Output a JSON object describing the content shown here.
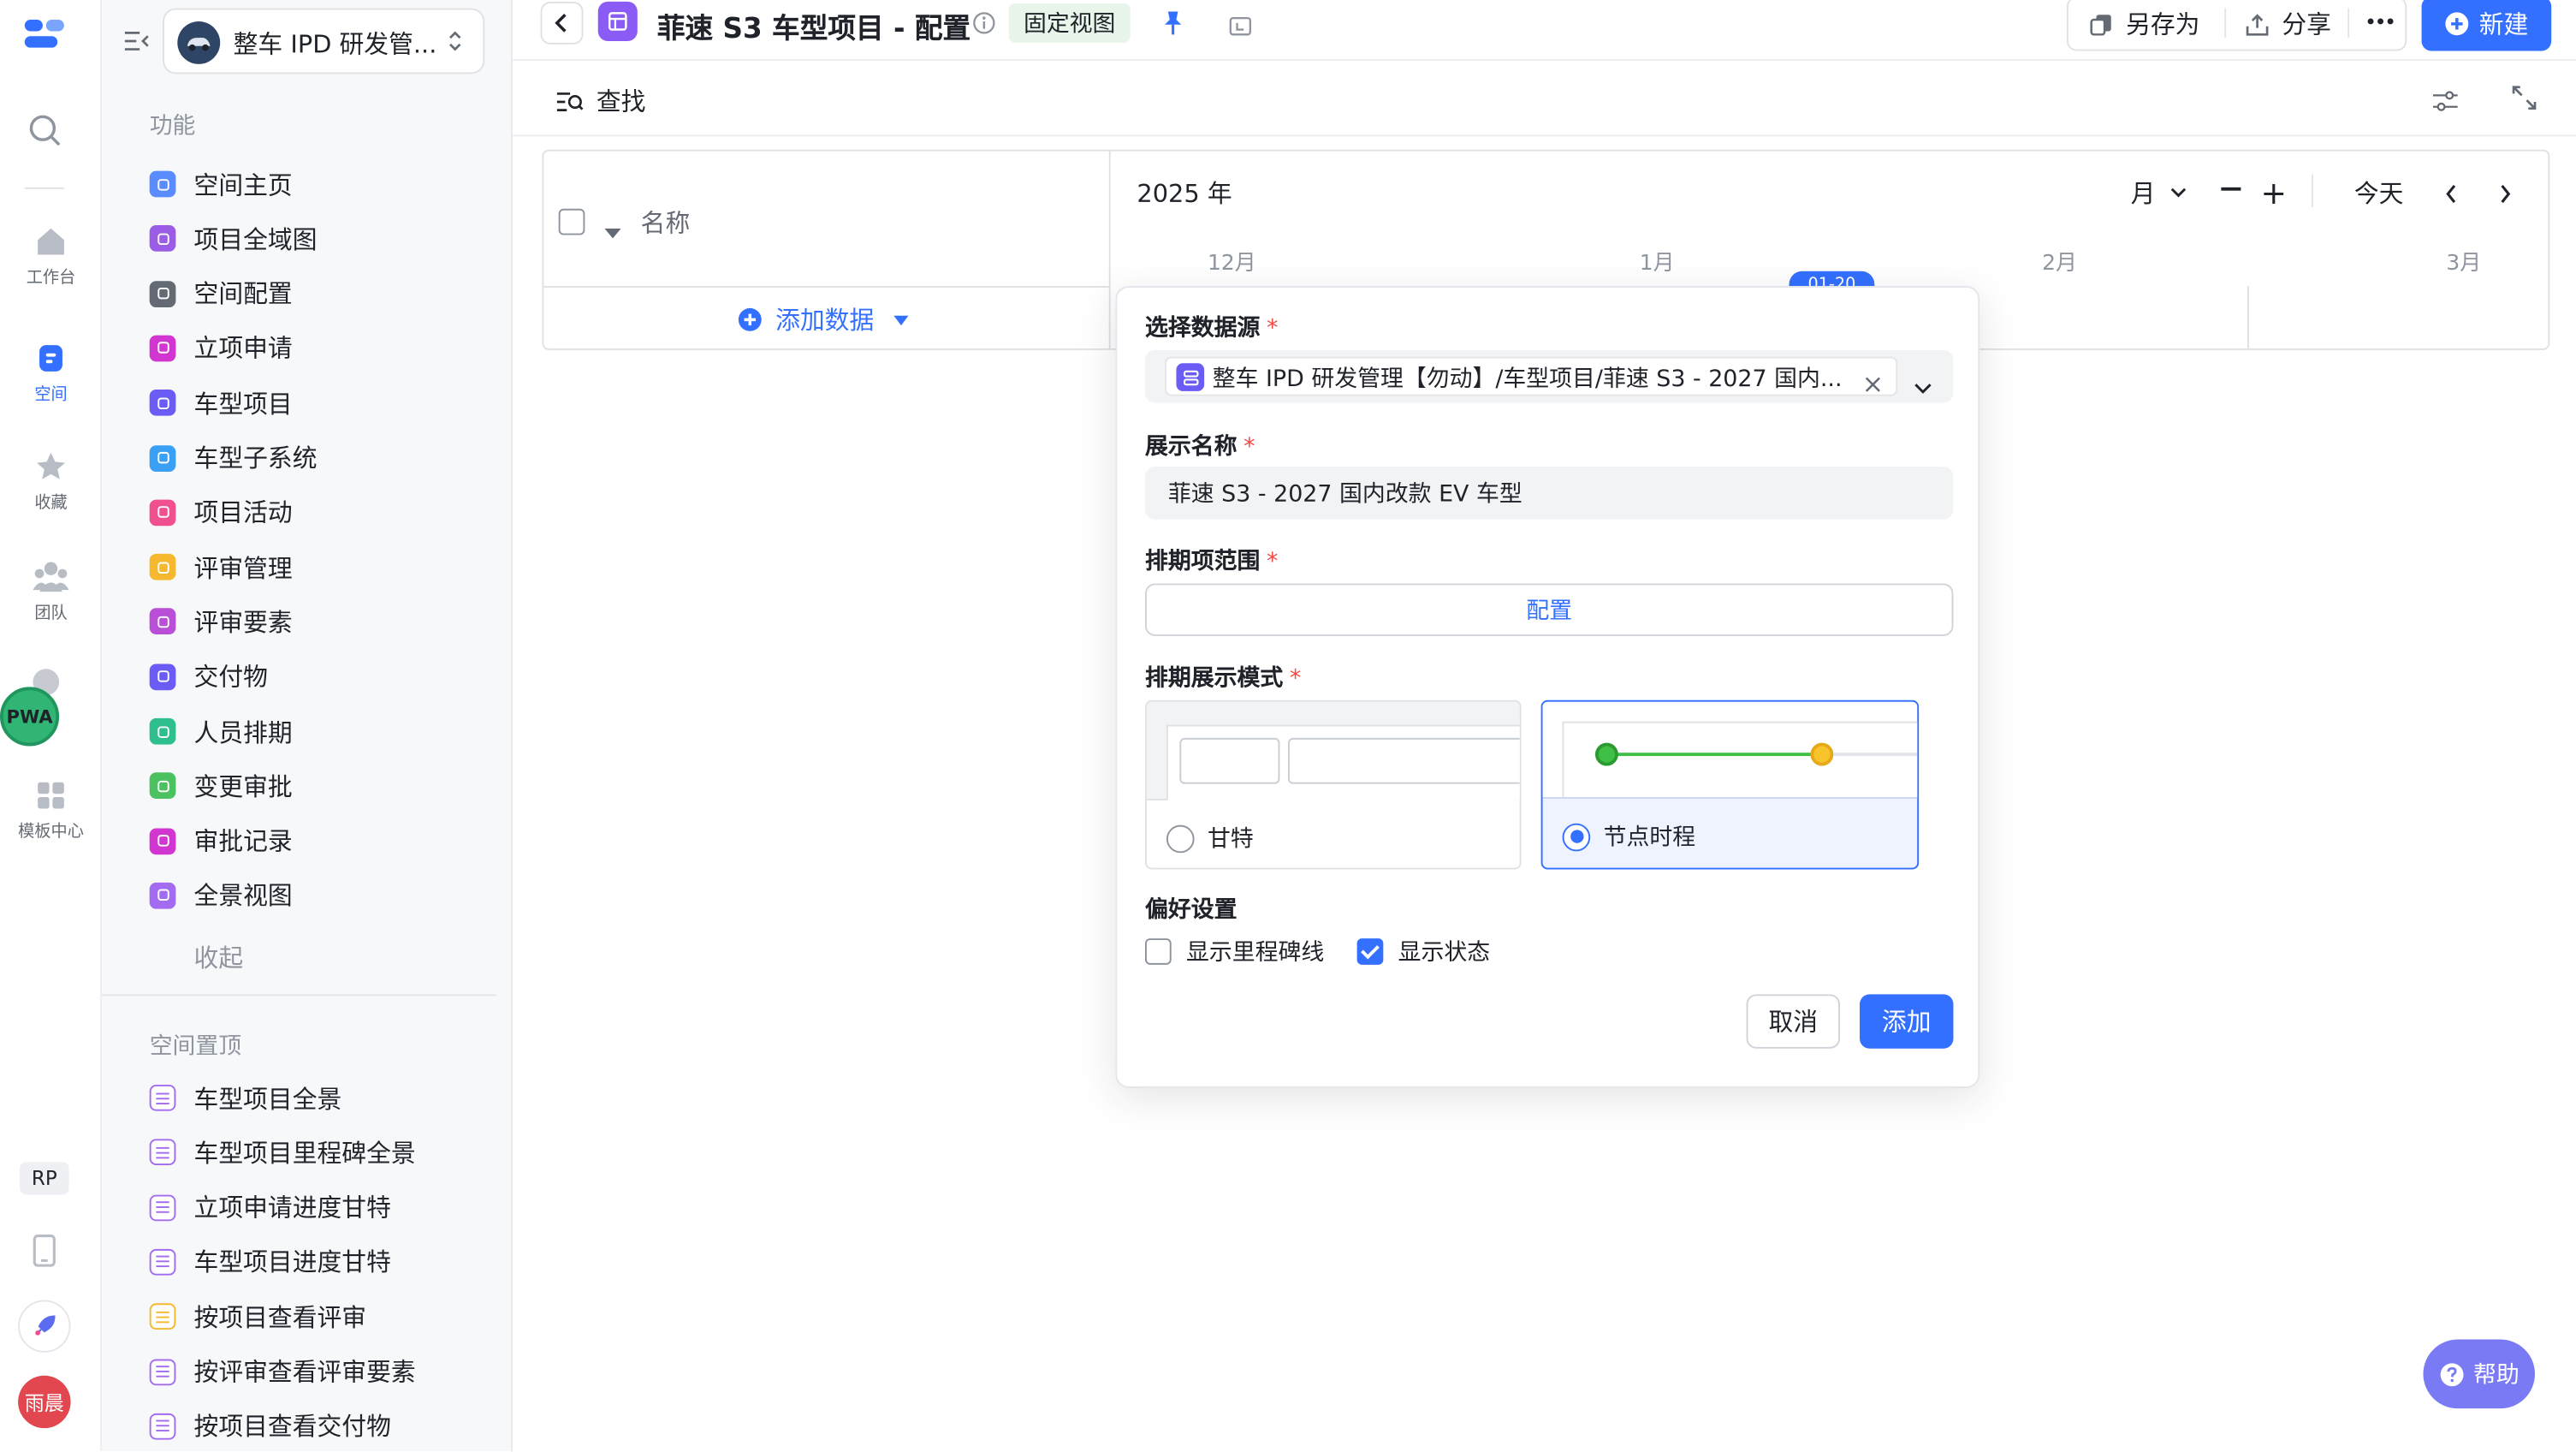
{
  "rail": {
    "items": [
      {
        "label": "工作台",
        "icon": "home-icon"
      },
      {
        "label": "空间",
        "icon": "space-icon"
      },
      {
        "label": "收藏",
        "icon": "star-icon"
      },
      {
        "label": "团队",
        "icon": "team-icon"
      },
      {
        "label": "模板中心",
        "icon": "template-icon"
      }
    ],
    "pwa_badge": "PWA",
    "rp_badge": "RP",
    "avatar": "雨晨"
  },
  "sidebar": {
    "workspace_name": "整车 IPD 研发管...",
    "section_features": "功能",
    "features": [
      {
        "label": "空间主页",
        "color": "#5b8cff"
      },
      {
        "label": "项目全域图",
        "color": "#9b5de5"
      },
      {
        "label": "空间配置",
        "color": "#646a73"
      },
      {
        "label": "立项申请",
        "color": "#d136d1"
      },
      {
        "label": "车型项目",
        "color": "#6a5cf5"
      },
      {
        "label": "车型子系统",
        "color": "#3aa0f5"
      },
      {
        "label": "项目活动",
        "color": "#f0508f"
      },
      {
        "label": "评审管理",
        "color": "#f5b82e"
      },
      {
        "label": "评审要素",
        "color": "#b84fd6"
      },
      {
        "label": "交付物",
        "color": "#6a5cf5"
      },
      {
        "label": "人员排期",
        "color": "#2fbf8f"
      },
      {
        "label": "变更审批",
        "color": "#4bc160"
      },
      {
        "label": "审批记录",
        "color": "#d136d1"
      },
      {
        "label": "全景视图",
        "color": "#a36cf0"
      }
    ],
    "collapse_label": "收起",
    "section_pinned": "空间置顶",
    "pinned": [
      {
        "label": "车型项目全景",
        "color": "#a36cf0"
      },
      {
        "label": "车型项目里程碑全景",
        "color": "#a36cf0"
      },
      {
        "label": "立项申请进度甘特",
        "color": "#a36cf0"
      },
      {
        "label": "车型项目进度甘特",
        "color": "#a36cf0"
      },
      {
        "label": "按项目查看评审",
        "color": "#f5b82e"
      },
      {
        "label": "按评审查看评审要素",
        "color": "#a36cf0"
      },
      {
        "label": "按项目查看交付物",
        "color": "#a36cf0"
      }
    ]
  },
  "header": {
    "title": "菲速 S3 车型项目 - 配置",
    "view_tag": "固定视图",
    "save_as": "另存为",
    "share": "分享",
    "new": "新建",
    "accent": "#3370ff"
  },
  "toolbar": {
    "search": "查找"
  },
  "timeline": {
    "year": "2025 年",
    "scale": "月",
    "today": "今天",
    "months": [
      "12月",
      "1月",
      "2月",
      "3月"
    ],
    "today_marker": "01-20",
    "name_col": "名称",
    "add_data": "添加数据"
  },
  "dialog": {
    "source_label": "选择数据源",
    "source_value": "整车 IPD 研发管理【勿动】/车型项目/菲速 S3 - 2027 国内...",
    "display_label": "展示名称",
    "display_value": "菲速 S3 - 2027 国内改款 EV 车型",
    "range_label": "排期项范围",
    "range_button": "配置",
    "mode_label": "排期展示模式",
    "mode_gantt": "甘特",
    "mode_timeline": "节点时程",
    "selected_mode": "节点时程",
    "prefs_label": "偏好设置",
    "pref_milestone": "显示里程碑线",
    "pref_milestone_checked": false,
    "pref_status": "显示状态",
    "pref_status_checked": true,
    "cancel": "取消",
    "add": "添加"
  },
  "help": {
    "label": "帮助"
  }
}
